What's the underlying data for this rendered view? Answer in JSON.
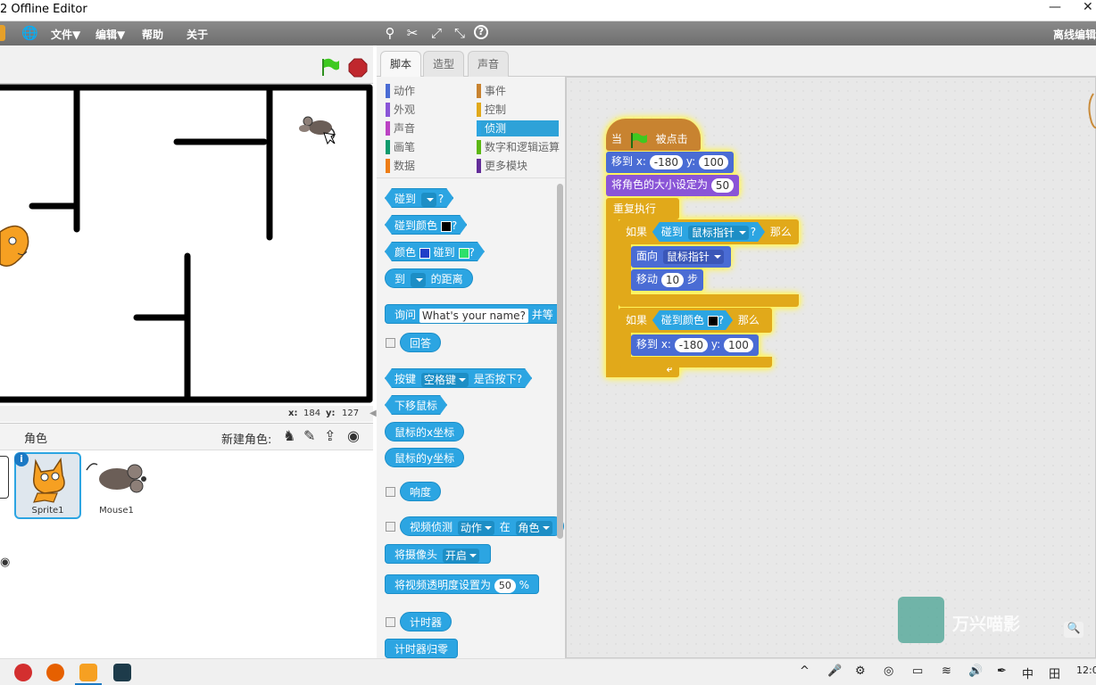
{
  "window": {
    "title": "2 Offline Editor",
    "minimize": "—",
    "close": "✕"
  },
  "menu": {
    "file": "文件▼",
    "edit": "编辑▼",
    "help": "帮助",
    "about": "关于",
    "offline": "离线编辑"
  },
  "stage": {
    "coords_x_label": "x:",
    "coords_x": "184",
    "coords_y_label": "y:",
    "coords_y": "127"
  },
  "sprites": {
    "header": "角色",
    "new_sprite_label": "新建角色:",
    "items": [
      {
        "name": "Sprite1"
      },
      {
        "name": "Mouse1"
      }
    ]
  },
  "tabs": [
    "脚本",
    "造型",
    "声音"
  ],
  "categories": {
    "left": [
      {
        "label": "动作",
        "color": "#4a6cd4"
      },
      {
        "label": "外观",
        "color": "#8a55d7"
      },
      {
        "label": "声音",
        "color": "#bb42c3"
      },
      {
        "label": "画笔",
        "color": "#0e9a6c"
      },
      {
        "label": "数据",
        "color": "#ee7d16"
      }
    ],
    "right": [
      {
        "label": "事件",
        "color": "#c88330"
      },
      {
        "label": "控制",
        "color": "#e1a91a"
      },
      {
        "label": "侦测",
        "color": "#2ca5e2"
      },
      {
        "label": "数字和逻辑运算",
        "color": "#5cb712"
      },
      {
        "label": "更多模块",
        "color": "#632d99"
      }
    ]
  },
  "palette": {
    "touching": "碰到",
    "q": "?",
    "touching_color": "碰到颜色",
    "color": "颜色",
    "touching2": "碰到",
    "to": "到",
    "distance": "的距离",
    "ask": "询问",
    "ask_default": "What's your name?",
    "and_wait": "并等",
    "answer": "回答",
    "key": "按键",
    "space": "空格键",
    "pressed": "是否按下?",
    "mouse_down": "下移鼠标",
    "mouse_x": "鼠标的x坐标",
    "mouse_y": "鼠标的y坐标",
    "loudness": "响度",
    "video_motion": "视频侦测",
    "motion": "动作",
    "on": "在",
    "sprite": "角色",
    "turn_video": "将摄像头",
    "video_on": "开启",
    "set_transparency": "将视频透明度设置为",
    "transparency": "50",
    "percent": "%",
    "timer": "计时器",
    "reset_timer": "计时器归零"
  },
  "script": {
    "when": "当",
    "clicked": "被点击",
    "goto": "移到 x:",
    "x1": "-180",
    "y_label": "y:",
    "y1": "100",
    "set_size": "将角色的大小设定为",
    "size": "50",
    "forever": "重复执行",
    "if1": "如果",
    "touching": "碰到",
    "mouse_pointer": "鼠标指针",
    "q": "?",
    "then": "那么",
    "point_towards": "面向",
    "point_target": "鼠标指针",
    "move": "移动",
    "steps": "10",
    "steps_label": "步",
    "if2": "如果",
    "touching_color": "碰到颜色",
    "then2": "那么",
    "goto2": "移到 x:",
    "x2": "-180",
    "y2_label": "y:",
    "y2": "100"
  },
  "watermark": "万兴喵影",
  "taskbar": {
    "ime": "中",
    "grid": "田",
    "time": "12:0"
  },
  "colors": {
    "motion": "#4a6cd4",
    "looks": "#8a55d7",
    "control": "#e1a91a",
    "events": "#c88330",
    "sensing": "#2ca5e2",
    "stop": "#c0272d",
    "flag": "#3ec920"
  }
}
